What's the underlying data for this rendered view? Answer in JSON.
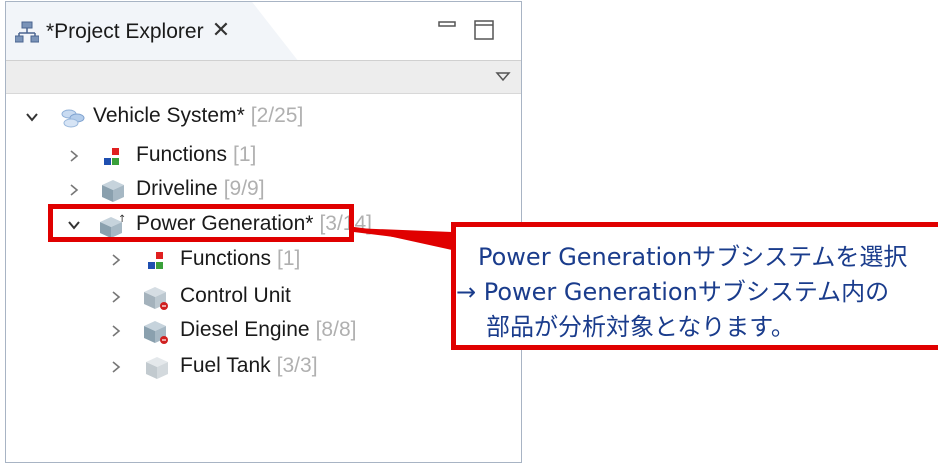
{
  "panel": {
    "title": "*Project Explorer",
    "close_glyph": "✕",
    "icons": {
      "tab": "project-explorer-icon",
      "minimize": "minimize-icon",
      "maximize": "maximize-icon",
      "view_menu": "view-menu-icon"
    }
  },
  "tree": {
    "nodes": [
      {
        "label": "Vehicle System*",
        "count": "[2/25]",
        "expanded": true,
        "icon": "system-icon"
      },
      {
        "label": "Functions",
        "count": "[1]",
        "expanded": false,
        "icon": "functions-icon"
      },
      {
        "label": "Driveline",
        "count": "[9/9]",
        "expanded": false,
        "icon": "cube-icon"
      },
      {
        "label": "Power Generation*",
        "count": "[3/14]",
        "expanded": true,
        "icon": "subsystem-cube-icon",
        "selected": true
      },
      {
        "label": "Functions",
        "count": "[1]",
        "expanded": false,
        "icon": "functions-icon"
      },
      {
        "label": "Control Unit",
        "count": "",
        "expanded": false,
        "icon": "component-cube-icon"
      },
      {
        "label": "Diesel Engine",
        "count": "[8/8]",
        "expanded": false,
        "icon": "component-cube-icon"
      },
      {
        "label": "Fuel Tank",
        "count": "[3/3]",
        "expanded": false,
        "icon": "light-cube-icon"
      }
    ]
  },
  "callout": {
    "line1": "Power Generationサブシステムを選択",
    "line2": "→ Power Generationサブシステム内の",
    "line3": "部品が分析対象となります。"
  },
  "colors": {
    "annotation_red": "#e00000",
    "callout_text": "#1a3c8c",
    "count_text": "#b0b0b0"
  }
}
